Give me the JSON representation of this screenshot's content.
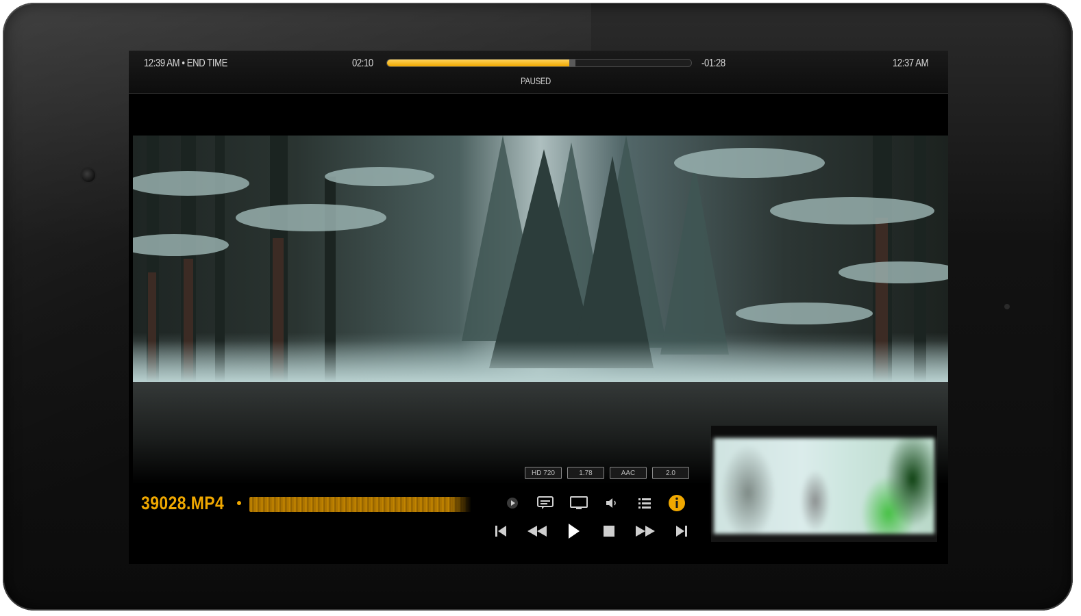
{
  "player": {
    "end_time": "12:39 AM • END TIME",
    "elapsed": "02:10",
    "remaining": "-01:28",
    "clock": "12:37 AM",
    "status": "PAUSED",
    "progress_fraction": 0.6,
    "filename": "39028.MP4",
    "accent_color": "#f0a800"
  },
  "badges": [
    {
      "label": "HD 720"
    },
    {
      "label": "1.78"
    },
    {
      "label": "AAC"
    },
    {
      "label": "2.0"
    }
  ],
  "controls_top": [
    {
      "name": "speed-icon"
    },
    {
      "name": "subtitles-icon"
    },
    {
      "name": "screen-icon"
    },
    {
      "name": "volume-icon"
    },
    {
      "name": "playlist-icon"
    },
    {
      "name": "info-icon"
    }
  ],
  "controls_bottom": [
    {
      "name": "skip-previous-icon"
    },
    {
      "name": "rewind-icon"
    },
    {
      "name": "play-icon"
    },
    {
      "name": "stop-icon"
    },
    {
      "name": "fast-forward-icon"
    },
    {
      "name": "skip-next-icon"
    }
  ]
}
